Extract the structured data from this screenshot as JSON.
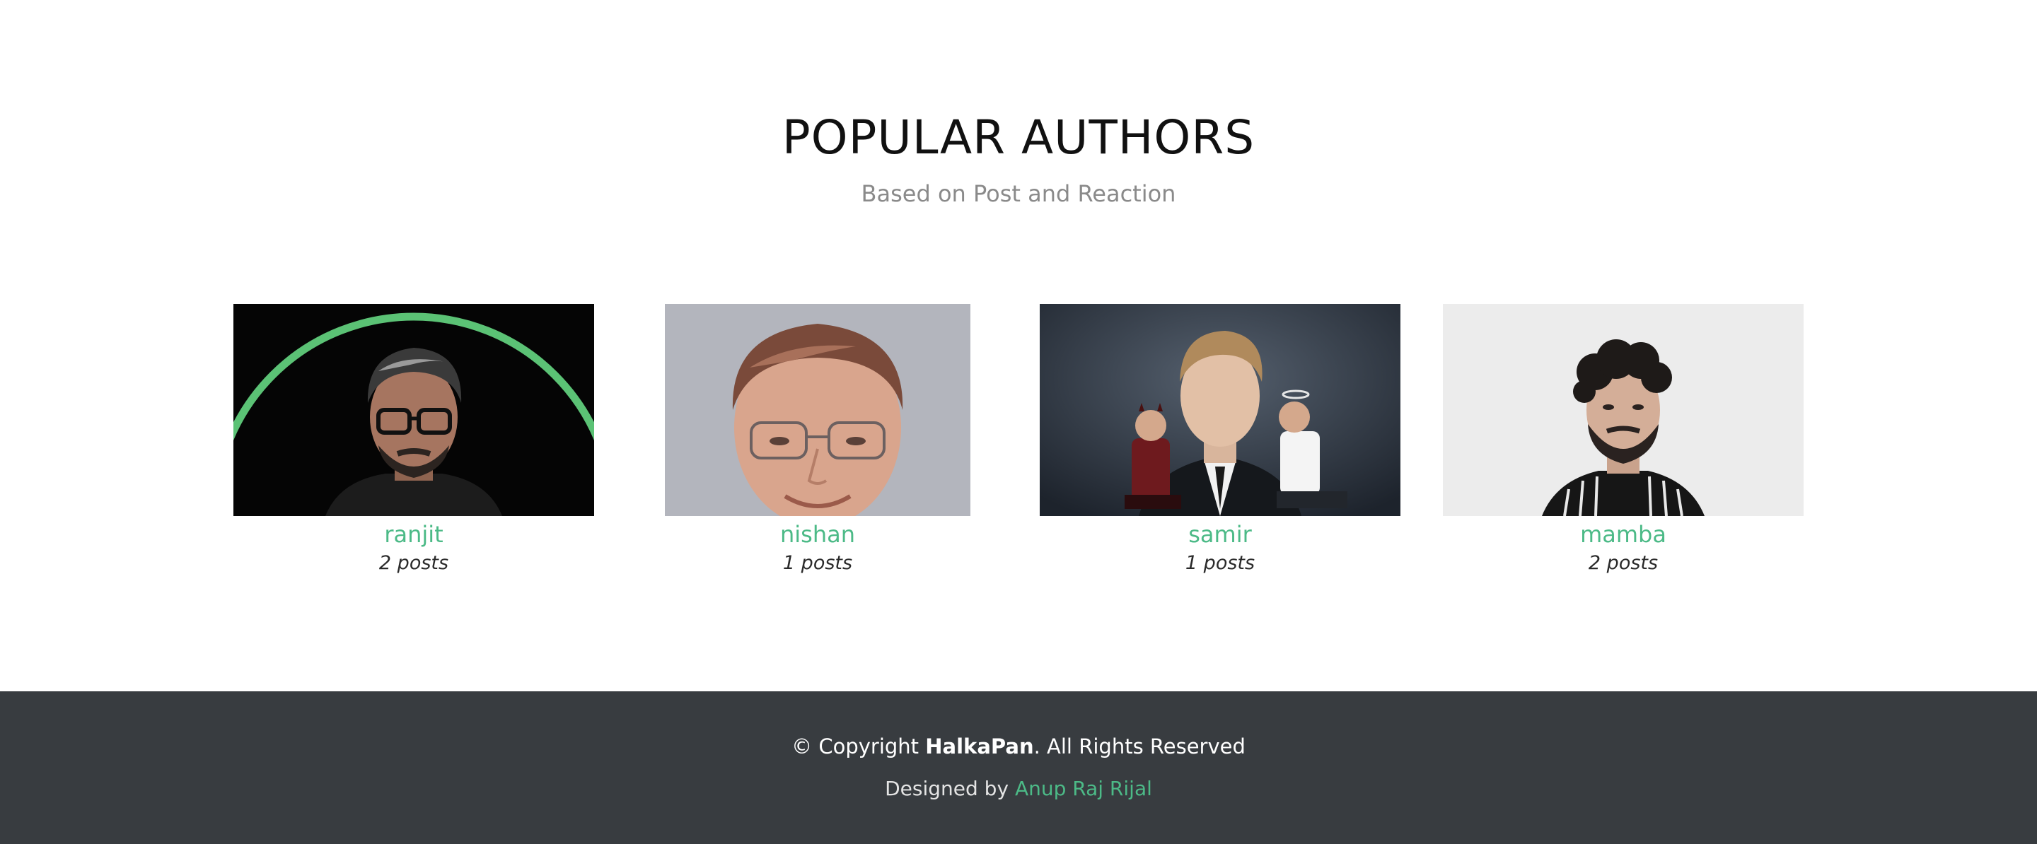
{
  "section": {
    "title": "POPULAR AUTHORS",
    "subtitle": "Based on Post and Reaction"
  },
  "authors": [
    {
      "name": "ranjit",
      "posts": "2 posts"
    },
    {
      "name": "nishan",
      "posts": "1 posts"
    },
    {
      "name": "samir",
      "posts": "1 posts"
    },
    {
      "name": "mamba",
      "posts": "2 posts"
    }
  ],
  "footer": {
    "copyright_prefix": "© Copyright ",
    "brand": "HalkaPan",
    "copyright_suffix": ". All Rights Reserved",
    "designed_prefix": "Designed by ",
    "designer": "Anup Raj Rijal"
  },
  "colors": {
    "accent": "#4cba87",
    "footer_bg": "#383c40",
    "title": "#111111",
    "subtitle": "#8a8a8a"
  }
}
